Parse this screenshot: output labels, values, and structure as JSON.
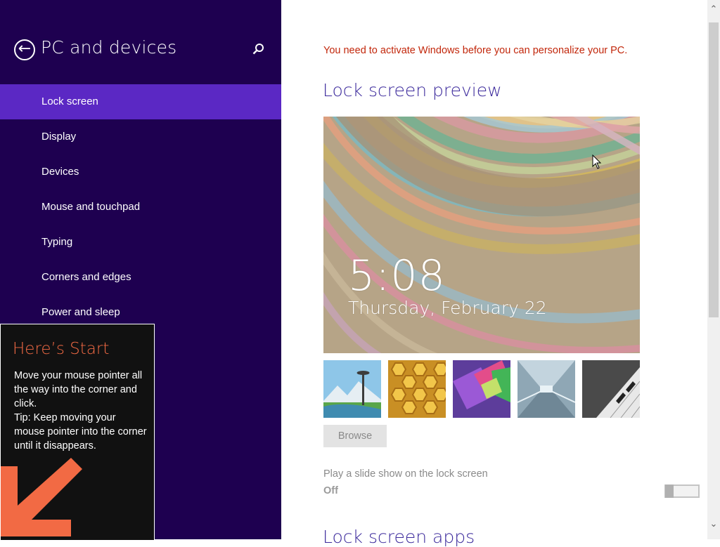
{
  "nav": {
    "back_icon": "back-arrow-icon",
    "title": "PC and devices",
    "search_icon": "search-icon",
    "background": "#1e0050",
    "selected_background": "#5b28c4",
    "items": [
      {
        "label": "Lock screen",
        "selected": true
      },
      {
        "label": "Display",
        "selected": false
      },
      {
        "label": "Devices",
        "selected": false
      },
      {
        "label": "Mouse and touchpad",
        "selected": false
      },
      {
        "label": "Typing",
        "selected": false
      },
      {
        "label": "Corners and edges",
        "selected": false
      },
      {
        "label": "Power and sleep",
        "selected": false
      }
    ]
  },
  "start_tip": {
    "title": "Here’s Start",
    "body": "Move your mouse pointer all the way into the corner and click.\nTip: Keep moving your mouse pointer into the corner until it disappears.",
    "arrow_icon": "down-left-arrow-icon",
    "accent": "#f26a44"
  },
  "content": {
    "activation_message": "You need to activate Windows before you can personalize your PC.",
    "lock_screen_heading": "Lock screen preview",
    "preview": {
      "time": "5:08",
      "date": "Thursday, February 22"
    },
    "thumbnails": [
      {
        "name": "space-needle"
      },
      {
        "name": "honeycomb"
      },
      {
        "name": "geometric-shapes"
      },
      {
        "name": "light-tunnel"
      },
      {
        "name": "piano-keys"
      }
    ],
    "browse_label": "Browse",
    "slideshow_label": "Play a slide show on the lock screen",
    "slideshow_state": "Off",
    "slideshow_on": false,
    "apps_heading": "Lock screen apps",
    "warning_color": "#c2270b",
    "heading_color": "#3c2a9c"
  },
  "scrollbar": {
    "up_icon": "scroll-up-arrow-icon",
    "down_icon": "scroll-down-arrow-icon"
  }
}
